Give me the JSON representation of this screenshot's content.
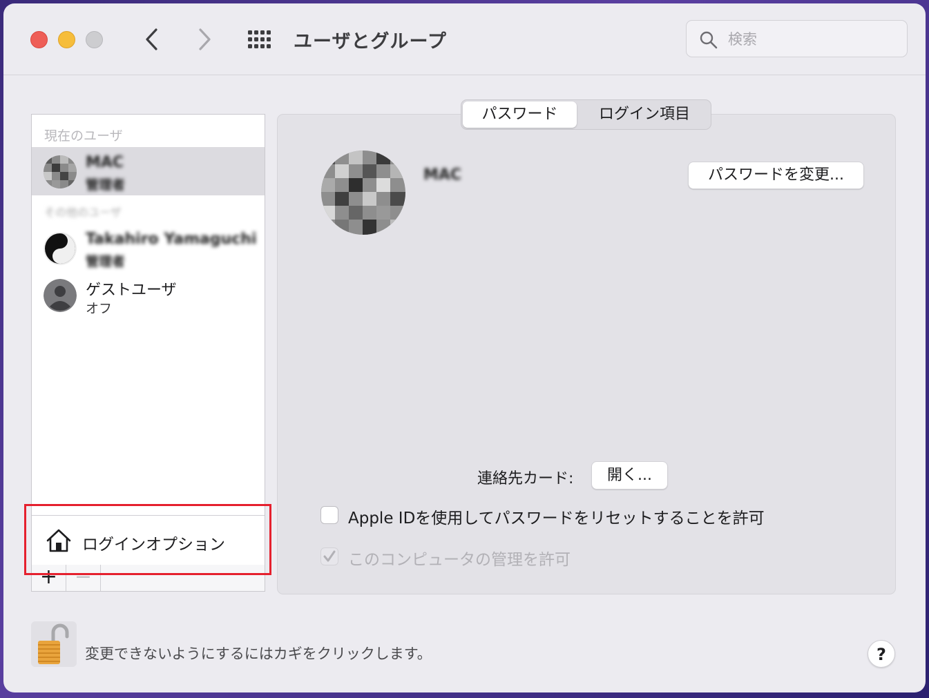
{
  "window": {
    "title": "ユーザとグループ"
  },
  "search": {
    "placeholder": "検索"
  },
  "sidebar": {
    "current_user_header": "現在のユーザ",
    "other_users_header": "その他のユーザ",
    "users": [
      {
        "name": "MAC",
        "role": "管理者",
        "selected": true,
        "icon": "user-avatar-photo"
      },
      {
        "name": "Takahiro Yamaguchi",
        "role": "管理者",
        "selected": false,
        "icon": "user-avatar-yinyang"
      },
      {
        "name": "ゲストユーザ",
        "role": "オフ",
        "selected": false,
        "icon": "person-icon"
      }
    ],
    "login_options_label": "ログインオプション",
    "add_label": "+",
    "remove_label": "−"
  },
  "tabs": {
    "password": "パスワード",
    "login_items": "ログイン項目",
    "selected": "password"
  },
  "main": {
    "user_name": "MAC",
    "change_password_label": "パスワードを変更...",
    "contact_card_label": "連絡先カード:",
    "open_label": "開く...",
    "allow_apple_id_reset": "Apple IDを使用してパスワードをリセットすることを許可",
    "allow_admin": "このコンピュータの管理を許可",
    "apple_id_checked": false,
    "admin_checked": true
  },
  "footer": {
    "lock_text": "変更できないようにするにはカギをクリックします。",
    "help_label": "?"
  },
  "colors": {
    "highlight": "#e5202e",
    "close": "#ee5e57",
    "minimize": "#f6bd3b"
  }
}
